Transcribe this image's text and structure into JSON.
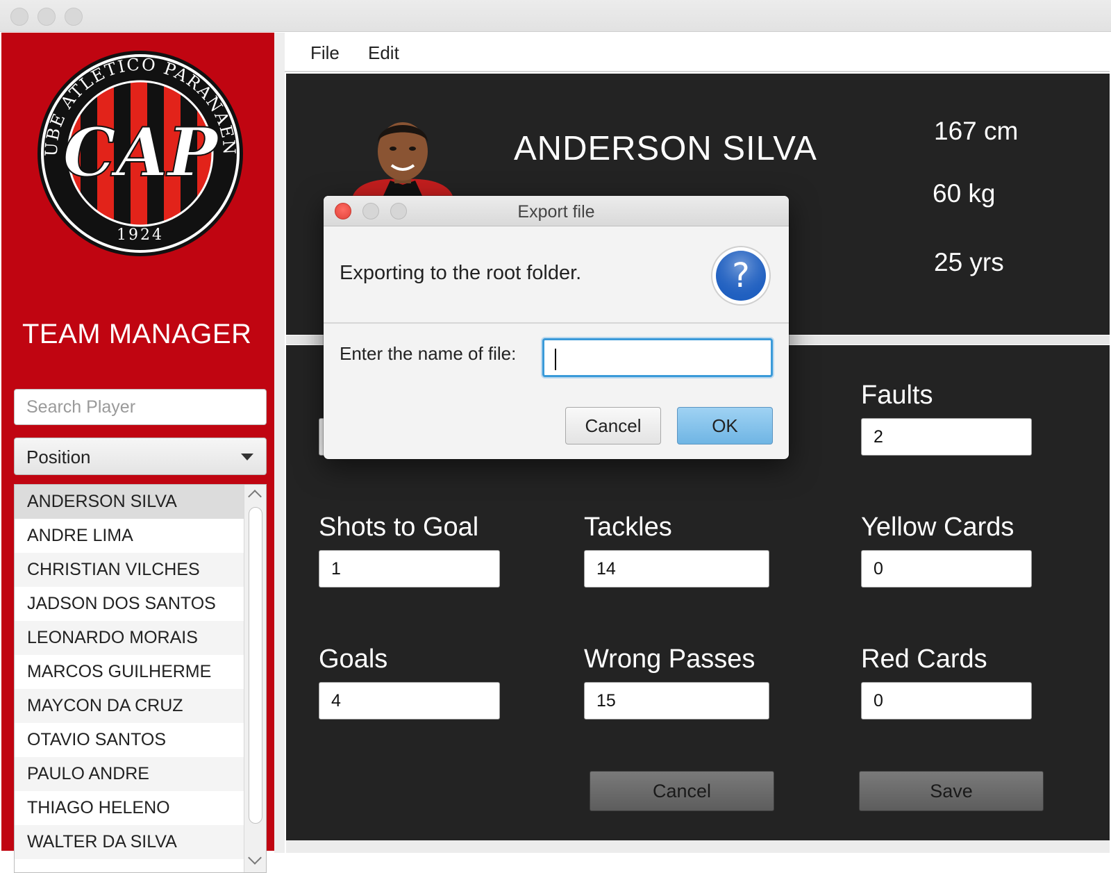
{
  "sidebar": {
    "logo": {
      "ring_text": "CLUBE ATLÉTICO PARANAENSE",
      "year": "1924",
      "monogram": "CAP"
    },
    "title": "TEAM MANAGER",
    "search_placeholder": "Search Player",
    "position_select": "Position",
    "players": [
      "ANDERSON SILVA",
      "ANDRE LIMA",
      "CHRISTIAN VILCHES",
      "JADSON DOS SANTOS",
      "LEONARDO MORAIS",
      "MARCOS GUILHERME",
      "MAYCON DA CRUZ",
      "OTAVIO SANTOS",
      "PAULO ANDRE",
      "THIAGO HELENO",
      "WALTER DA SILVA"
    ],
    "selected_player": "ANDERSON SILVA"
  },
  "menu": {
    "file": "File",
    "edit": "Edit"
  },
  "player": {
    "name": "ANDERSON SILVA",
    "height": "167 cm",
    "weight": "60 kg",
    "age": "25 yrs"
  },
  "stats": {
    "faults": {
      "label": "Faults",
      "value": "2"
    },
    "shots_to_goal": {
      "label": "Shots to Goal",
      "value": "1"
    },
    "tackles": {
      "label": "Tackles",
      "value": "14"
    },
    "yellow_cards": {
      "label": "Yellow Cards",
      "value": "0"
    },
    "goals": {
      "label": "Goals",
      "value": "4"
    },
    "wrong_passes": {
      "label": "Wrong Passes",
      "value": "15"
    },
    "red_cards": {
      "label": "Red Cards",
      "value": "0"
    }
  },
  "actions": {
    "cancel": "Cancel",
    "save": "Save"
  },
  "dialog": {
    "title": "Export file",
    "message": "Exporting to the root folder.",
    "icon": "question-icon",
    "prompt": "Enter the name of file:",
    "input_value": "",
    "cancel": "Cancel",
    "ok": "OK"
  },
  "colors": {
    "sidebar_red": "#c00511",
    "panel_dark": "#232323",
    "dialog_accent": "#3a9ad9"
  }
}
